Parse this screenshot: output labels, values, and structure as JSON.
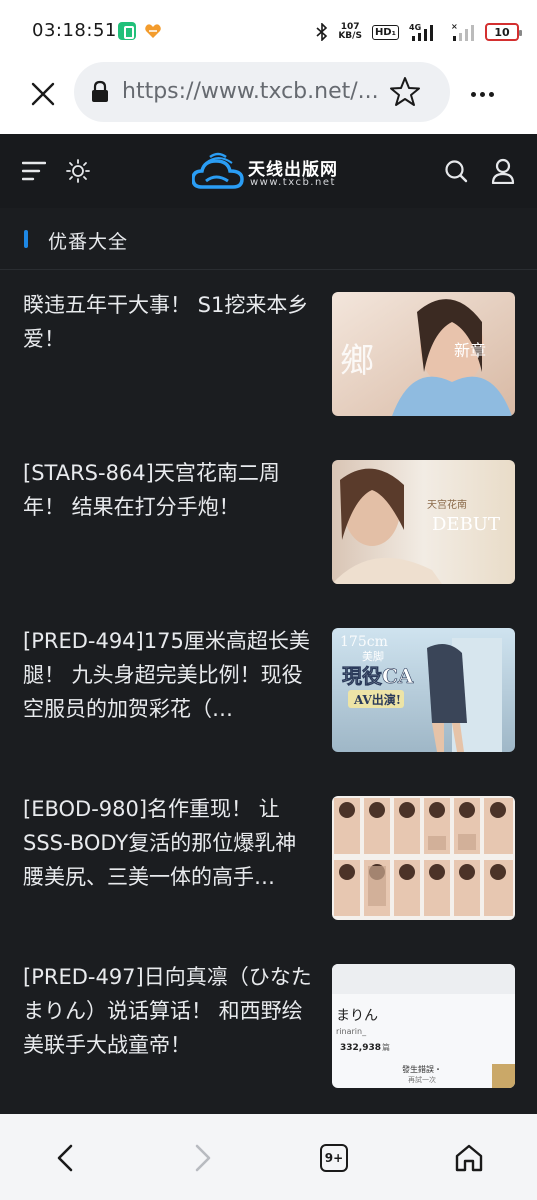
{
  "status_bar": {
    "time": "03:18:51",
    "net_speed_value": "107",
    "net_speed_unit": "KB/S",
    "hd_label": "HD₁",
    "network_label": "4G",
    "battery": "10"
  },
  "browser": {
    "url": "https://www.txcb.net/...",
    "icons": [
      "close-icon",
      "lock-icon",
      "star-icon",
      "more-icon"
    ]
  },
  "site": {
    "logo_title": "天线出版网",
    "logo_subtitle": "www.txcb.net",
    "section_title": "优番大全"
  },
  "articles": [
    {
      "title": "睽违五年干大事！ S1挖来本乡爱！",
      "thumb_text": "鄉",
      "thumb_caption": "新章"
    },
    {
      "title": "[STARS-864]天宫花南二周年！ 结果在打分手炮！",
      "thumb_text": "DEBUT",
      "thumb_caption": "天宫花南"
    },
    {
      "title": "[PRED-494]175厘米高超长美腿！ 九头身超完美比例！现役空服员的加贺彩花（…",
      "thumb_text": "現役CA",
      "thumb_caption": "美脚"
    },
    {
      "title": "[EBOD-980]名作重现！ 让SSS-BODY复活的那位爆乳神腰美尻、三美一体的高手…",
      "thumb_text": "",
      "thumb_caption": ""
    },
    {
      "title": "[PRED-497]日向真凛（ひなたまりん）说话算话！ 和西野绘美联手大战童帝！",
      "thumb_text": "まりん",
      "thumb_caption": "332,938"
    }
  ],
  "bottom_nav": {
    "tabs_count": "9+"
  },
  "colors": {
    "page_bg": "#1b1d20",
    "accent": "#1e88e5",
    "battery_low": "#d32f2f"
  }
}
